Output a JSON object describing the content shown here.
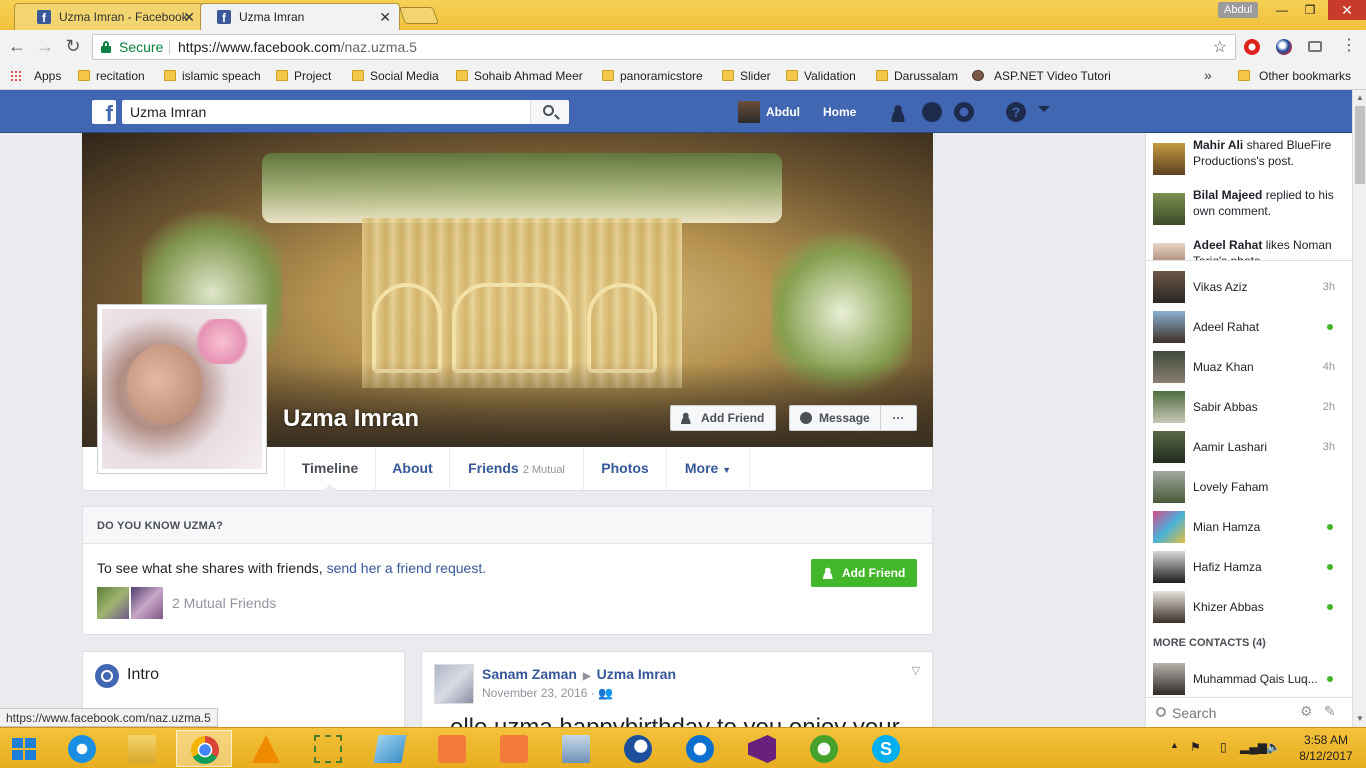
{
  "browser": {
    "tabs": [
      {
        "title": "Uzma Imran - Facebook",
        "active": false
      },
      {
        "title": "Uzma Imran",
        "active": true
      }
    ],
    "profile_name": "Abdul",
    "secure_label": "Secure",
    "url_host": "https://www.facebook.com",
    "url_path": "/naz.uzma.5",
    "bookmarks": [
      "Apps",
      "recitation",
      "islamic speach",
      "Project",
      "Social Media",
      "Sohaib Ahmad Meer",
      "panoramicstore",
      "Slider",
      "Validation",
      "Darussalam",
      "ASP.NET Video Tutori"
    ],
    "bookmarks_overflow": "»",
    "other_bookmarks": "Other bookmarks",
    "status_url": "https://www.facebook.com/naz.uzma.5"
  },
  "fb": {
    "logo": "f",
    "search_value": "Uzma Imran",
    "user_name": "Abdul",
    "home_label": "Home"
  },
  "profile": {
    "name": "Uzma Imran",
    "add_friend": "Add Friend",
    "message": "Message",
    "more_dots": "···",
    "tabs": {
      "timeline": "Timeline",
      "about": "About",
      "friends": "Friends",
      "friends_sub": "2 Mutual",
      "photos": "Photos",
      "more": "More"
    }
  },
  "know": {
    "heading": "DO YOU KNOW UZMA?",
    "text": "To see what she shares with friends,",
    "link": "send her a friend request.",
    "button": "Add Friend",
    "mutual": "2 Mutual Friends"
  },
  "intro": {
    "title": "Intro"
  },
  "post": {
    "author": "Sanam Zaman",
    "target": "Uzma Imran",
    "date": "November 23, 2016 ·",
    "body": "ello uzma happybirthday to you enjoy your"
  },
  "ticker": [
    {
      "name": "Mahir Ali",
      "text": "shared BlueFire Productions's post."
    },
    {
      "name": "Bilal Majeed",
      "text": "replied to his own comment."
    },
    {
      "name": "Adeel Rahat",
      "text": "likes Noman Tariq's photo."
    }
  ],
  "chat": [
    {
      "name": "Vikas Aziz",
      "time": "3h",
      "online": false
    },
    {
      "name": "Adeel Rahat",
      "time": "",
      "online": true
    },
    {
      "name": "Muaz Khan",
      "time": "4h",
      "online": false
    },
    {
      "name": "Sabir Abbas",
      "time": "2h",
      "online": false
    },
    {
      "name": "Aamir Lashari",
      "time": "3h",
      "online": false
    },
    {
      "name": "Lovely Faham",
      "time": "",
      "online": false
    },
    {
      "name": "Mian Hamza",
      "time": "",
      "online": true
    },
    {
      "name": "Hafiz Hamza",
      "time": "",
      "online": true
    },
    {
      "name": "Khizer Abbas",
      "time": "",
      "online": true
    }
  ],
  "more_contacts": "MORE CONTACTS (4)",
  "more_contact": {
    "name": "Muhammad Qais Luq...",
    "online": true
  },
  "chat_search_placeholder": "Search",
  "clock": {
    "time": "3:58 AM",
    "date": "8/12/2017"
  },
  "colors": {
    "fb_blue": "#4267b2",
    "link": "#365899",
    "green": "#42b72a",
    "taskbar": "#f4c23c"
  }
}
